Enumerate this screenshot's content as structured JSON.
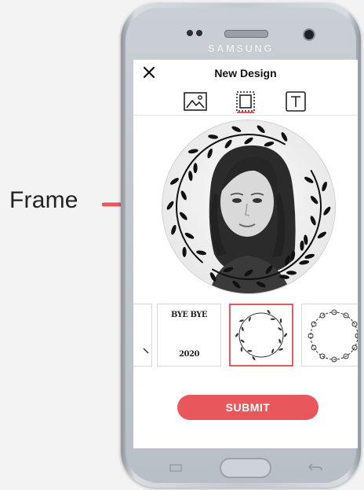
{
  "annotation": {
    "label": "Frame",
    "arrow_color": "#e8575b"
  },
  "device": {
    "brand": "SAMSUNG"
  },
  "app": {
    "title": "New Design",
    "close_icon": "close-icon",
    "tabs": [
      {
        "icon": "image-icon",
        "active": false
      },
      {
        "icon": "frame-icon",
        "active": true
      },
      {
        "icon": "text-icon",
        "active": false
      }
    ],
    "accent_color": "#e25a5a",
    "thumbnails": [
      {
        "name": "partial-frame",
        "selected": false
      },
      {
        "name": "bye-bye-2020",
        "top_text": "BYE BYE",
        "bottom_text": "2020",
        "selected": false
      },
      {
        "name": "leaf-wreath",
        "selected": true
      },
      {
        "name": "flower-wreath",
        "selected": false
      }
    ],
    "submit_label": "SUBMIT"
  }
}
